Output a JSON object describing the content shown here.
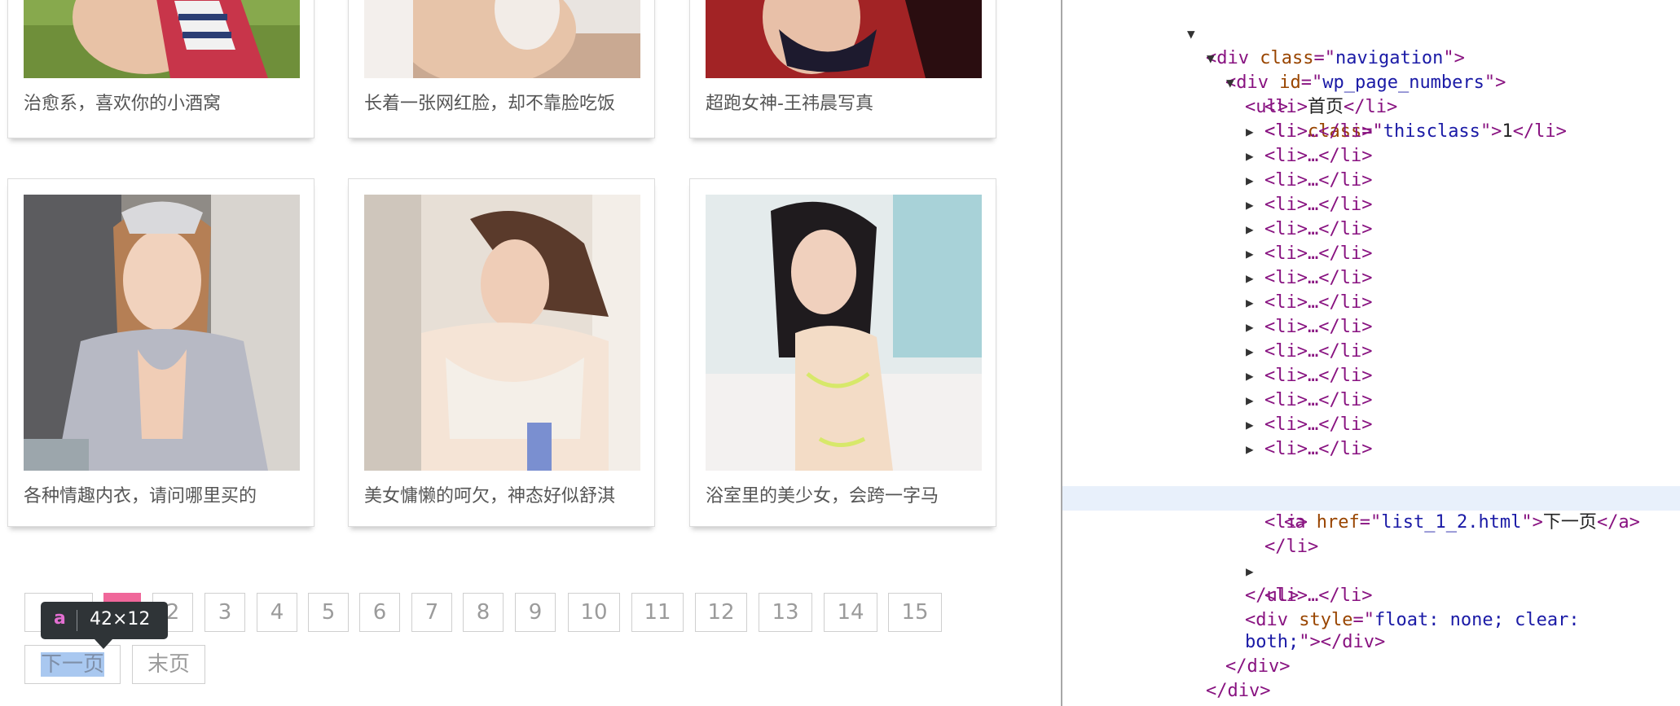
{
  "grid": {
    "row1": [
      {
        "caption": "治愈系，喜欢你的小酒窝"
      },
      {
        "caption": "长着一张网红脸，却不靠脸吃饭"
      },
      {
        "caption": "超跑女神-王祎晨写真"
      }
    ],
    "row2": [
      {
        "caption": "各种情趣内衣，请问哪里买的"
      },
      {
        "caption": "美女慵懒的呵欠，神态好似舒淇"
      },
      {
        "caption": "浴室里的美少女，会跨一字马"
      }
    ]
  },
  "pagination": {
    "pages": [
      "1",
      "2",
      "3",
      "4",
      "5",
      "6",
      "7",
      "8",
      "9",
      "10",
      "11",
      "12",
      "13",
      "14",
      "15"
    ],
    "current": "1",
    "next_label": "下一页",
    "last_label": "末页"
  },
  "tooltip": {
    "tag": "a",
    "dims": "42×12"
  },
  "devtools": {
    "lines": [
      {
        "open": "<",
        "tag": "div",
        "attr": "class",
        "val": "navigation",
        "close": ">"
      },
      {
        "open": "<",
        "tag": "div",
        "attr": "id",
        "val": "wp_page_numbers",
        "close": ">"
      },
      {
        "text": "<ul>"
      },
      {
        "text_li": "首页"
      },
      {
        "li_class": "thisclass",
        "li_text": "1"
      },
      {
        "collapsed": "<li>…</li>"
      },
      {
        "a_href": "list_1_2.html",
        "a_text": "下一页"
      },
      {
        "text": "</li>"
      },
      {
        "text": "</ul>"
      },
      {
        "div_style": "float: none; clear:",
        "div_style2": "both;"
      },
      {
        "text": "</div>"
      }
    ],
    "colors": {
      "tag": "#881280",
      "attr": "#994500",
      "value": "#1a1aa6",
      "selected_bg": "#e8f0fb"
    }
  },
  "colors": {
    "current_page": "#f0679a",
    "pager_border": "#cfcfcf",
    "tooltip_bg": "#2f3437"
  }
}
